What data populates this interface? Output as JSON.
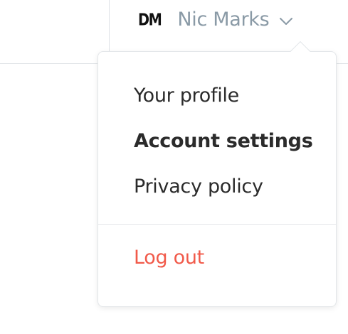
{
  "header": {
    "avatar_initials": "DM",
    "user_name": "Nic Marks",
    "chevron_icon": "chevron-down-icon"
  },
  "menu": {
    "items": [
      {
        "label": "Your profile"
      },
      {
        "label": "Account settings"
      },
      {
        "label": "Privacy policy"
      }
    ],
    "logout_label": "Log out"
  },
  "colors": {
    "user_name": "#8a9aa6",
    "logout": "#f15a4a",
    "divider": "#dfe3e7"
  }
}
